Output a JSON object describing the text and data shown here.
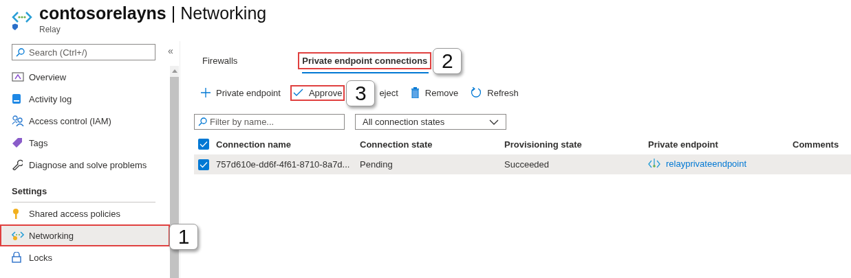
{
  "header": {
    "title": "**contosorelayns** | Networking",
    "subtitle": "Relay"
  },
  "sidebar": {
    "search": {
      "placeholder": "Search (Ctrl+/)"
    },
    "collapse": "«",
    "items": [
      {
        "kind": "item",
        "label": "Overview",
        "selected": false
      },
      {
        "kind": "item",
        "label": "Activity log",
        "selected": false
      },
      {
        "kind": "item",
        "label": "Access control (IAM)",
        "selected": false
      },
      {
        "kind": "item",
        "label": "Tags",
        "selected": false
      },
      {
        "kind": "item",
        "label": "Diagnose and solve problems",
        "selected": false
      },
      {
        "kind": "heading",
        "label": "Settings"
      },
      {
        "kind": "item",
        "label": "Shared access policies",
        "selected": false
      },
      {
        "kind": "item",
        "label": "Networking",
        "selected": true,
        "highlighted": true,
        "callout": "1"
      },
      {
        "kind": "item",
        "label": "Locks",
        "selected": false
      }
    ]
  },
  "tabs": [
    {
      "label": "Firewalls",
      "selected": false,
      "highlighted": false
    },
    {
      "label": "Private endpoint connections",
      "selected": true,
      "highlighted": true,
      "callout": "2"
    }
  ],
  "toolbar": [
    {
      "kind": "add",
      "label": "Private endpoint",
      "highlighted": false
    },
    {
      "kind": "approve",
      "label": "Approve",
      "highlighted": true,
      "callout": "3"
    },
    {
      "kind": "reject",
      "label": "eject",
      "highlighted": false
    },
    {
      "kind": "remove",
      "label": "Remove",
      "highlighted": false
    },
    {
      "kind": "refresh",
      "label": "Refresh",
      "highlighted": false
    }
  ],
  "filter": {
    "placeholder": "Filter by name..."
  },
  "state_filter": {
    "value": "All connection states"
  },
  "table": {
    "all_checked": true,
    "columns": [
      "Connection name",
      "Connection state",
      "Provisioning state",
      "Private endpoint",
      "Comments"
    ],
    "rows": [
      {
        "checked": true,
        "selected": true,
        "name": "757d610e-dd6f-4f61-8710-8a7d...",
        "state": "Pending",
        "provisioning": "Succeeded",
        "endpoint": "relayprivateendpoint"
      }
    ]
  }
}
